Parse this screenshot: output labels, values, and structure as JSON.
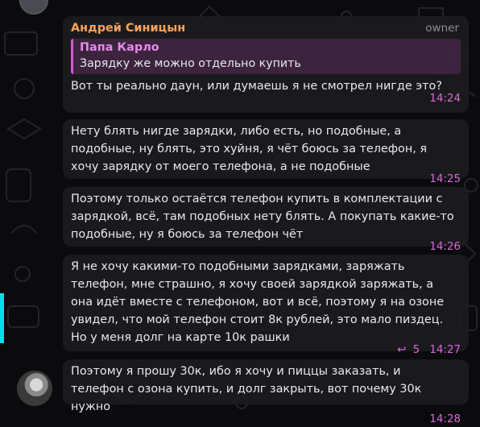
{
  "colors": {
    "background": "#0b0b0e",
    "sender_name": "#f7a35c",
    "reply_accent": "#d35bd8",
    "timestamp": "#d86ad8",
    "side_accent": "#00e0e8"
  },
  "message_group": {
    "sender": "Андрей Синицын",
    "role_badge": "owner",
    "messages": [
      {
        "reply_to": {
          "name": "Папа Карло",
          "text": "Зарядку же можно отдельно купить"
        },
        "text": "Вот ты реально даун, или думаешь я не смотрел нигде это?",
        "time": "14:24"
      },
      {
        "text": "Нету блять нигде зарядки, либо есть, но подобные, а подобные, ну блять, это хуйня, я чёт боюсь за телефон, я хочу зарядку от моего телефона, а не подобные",
        "time": "14:25"
      },
      {
        "text": "Поэтому только остаётся телефон купить в комплектации с зарядкой, всё, там подобных нету блять. А покупать какие-то подобные, ну я боюсь за телефон чёт",
        "time": "14:26"
      },
      {
        "text": "Я не хочу какими-то подобными зарядками, заряжать телефон, мне страшно, я хочу своей зарядкой заряжать, а она идёт вместе с телефоном, вот и всё, поэтому я на озоне увидел, что мой телефон стоит 8к рублей, это мало пиздец. Но у меня долг на карте 10к рашки",
        "time": "14:27",
        "reply_count": "5",
        "reply_icon": "reply-arrow-icon"
      },
      {
        "text": "Поэтому я прошу 30к, ибо я хочу и пиццы заказать, и телефон с озона купить, и долг закрыть, вот почему 30к нужно",
        "time": "14:28"
      }
    ]
  }
}
